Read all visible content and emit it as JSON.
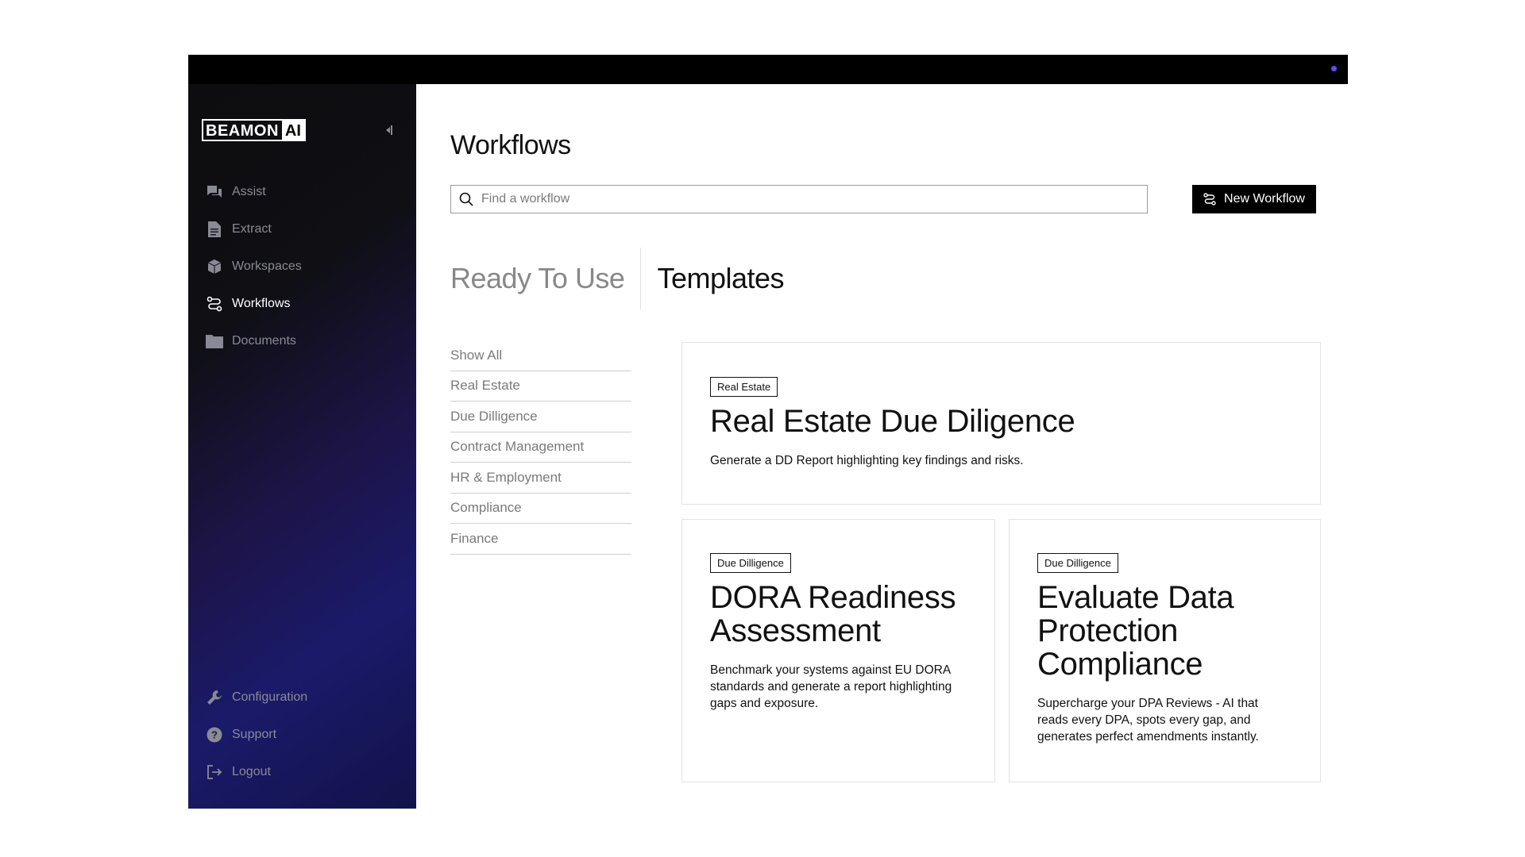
{
  "app": {
    "logo_text": "BEAMON",
    "logo_ai": "AI"
  },
  "sidebar": {
    "items": [
      {
        "label": "Assist",
        "icon": "chat-icon"
      },
      {
        "label": "Extract",
        "icon": "document-icon"
      },
      {
        "label": "Workspaces",
        "icon": "cube-icon"
      },
      {
        "label": "Workflows",
        "icon": "workflow-icon",
        "active": true
      },
      {
        "label": "Documents",
        "icon": "folder-icon"
      }
    ],
    "bottom_items": [
      {
        "label": "Configuration",
        "icon": "wrench-icon"
      },
      {
        "label": "Support",
        "icon": "help-icon"
      },
      {
        "label": "Logout",
        "icon": "logout-icon"
      }
    ]
  },
  "main": {
    "title": "Workflows",
    "search_placeholder": "Find a workflow",
    "new_button": "New Workflow",
    "tabs": [
      {
        "label": "Ready To Use",
        "active": false
      },
      {
        "label": "Templates",
        "active": true
      }
    ],
    "categories": [
      "Show All",
      "Real Estate",
      "Due Dilligence",
      "Contract Management",
      "HR & Employment",
      "Compliance",
      "Finance"
    ],
    "cards": [
      {
        "tag": "Real Estate",
        "title": "Real Estate Due Diligence",
        "description": "Generate a DD Report highlighting key findings and risks."
      },
      {
        "tag": "Due Dilligence",
        "title": "DORA Readiness Assessment",
        "description": "Benchmark your systems against EU DORA standards and generate a report highlighting gaps and exposure."
      },
      {
        "tag": "Due Dilligence",
        "title": "Evaluate Data Protection Compliance",
        "description": "Supercharge your DPA Reviews - AI that reads every DPA, spots every gap, and generates perfect amendments instantly."
      }
    ]
  },
  "colors": {
    "accent_dot": "#5b4dff",
    "sidebar_gradient_end": "#1a1a6a",
    "button_bg": "#000000"
  }
}
